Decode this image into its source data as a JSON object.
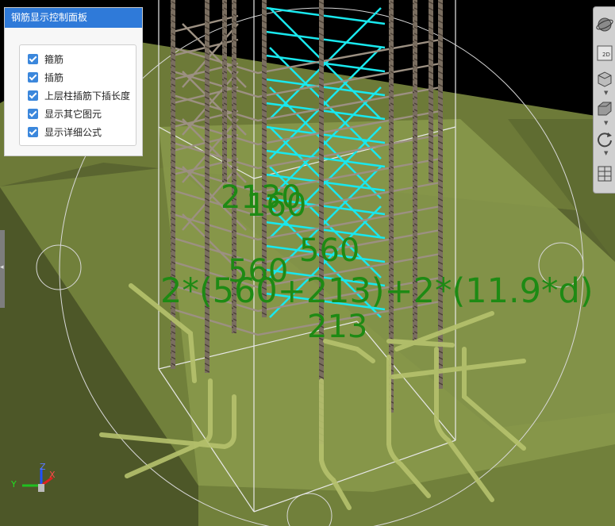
{
  "panel": {
    "title": "钢筋显示控制面板",
    "options": [
      {
        "label": "箍筋",
        "checked": true
      },
      {
        "label": "插筋",
        "checked": true
      },
      {
        "label": "上层柱插筋下插长度",
        "checked": true
      },
      {
        "label": "显示其它图元",
        "checked": true
      },
      {
        "label": "显示详细公式",
        "checked": true
      }
    ]
  },
  "toolbar": {
    "view_2d_label": "2D",
    "tools": [
      "orbit-icon",
      "view-2d-icon",
      "cube-view-icon",
      "box-view-icon",
      "rotate-icon",
      "table-icon"
    ]
  },
  "dimensions": {
    "top_overlap": "2130",
    "top_overlap_b": "160",
    "mid_560_right": "560",
    "mid_560_left": "560",
    "formula": "2*(560+213)+2*(11.9*d)",
    "bottom_213": "213"
  },
  "axis": {
    "x": "X",
    "y": "Y",
    "z": "Z"
  },
  "colors": {
    "background": "#000000",
    "footing": "#8a9a4c",
    "stirrup_highlight": "#19e8ee",
    "dimension_text": "#1e8a14",
    "panel_header": "#2f7ad9",
    "checkbox": "#3b87dc"
  }
}
